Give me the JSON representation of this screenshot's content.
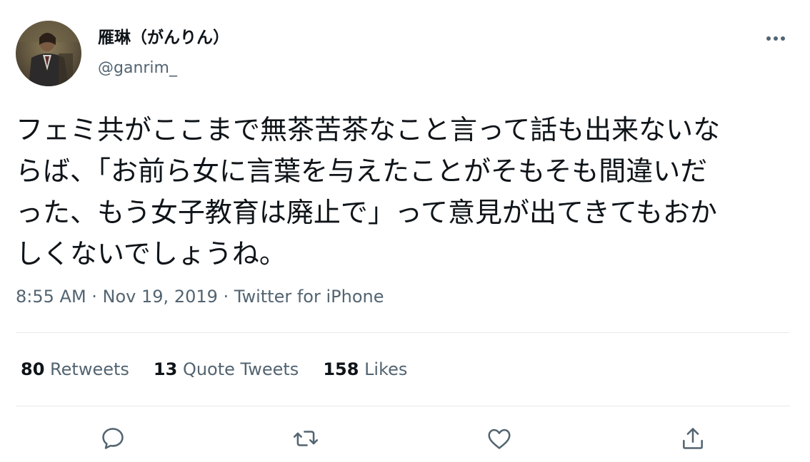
{
  "user": {
    "display_name": "雁琳（がんりん）",
    "handle": "@ganrim_"
  },
  "tweet": {
    "lines": [
      "フェミ共がここまで無茶苦茶なこと言って話も出来ないな",
      "らば、「お前ら女に言葉を与えたことがそもそも間違いだ",
      "った、もう女子教育は廃止で」って意見が出てきてもおか",
      "しくないでしょうね。"
    ]
  },
  "meta": {
    "time": "8:55 AM",
    "separator1": " · ",
    "date": "Nov 19, 2019",
    "separator2": " · ",
    "source": "Twitter for iPhone"
  },
  "stats": {
    "retweets": {
      "count": "80",
      "label": "Retweets"
    },
    "quotes": {
      "count": "13",
      "label": "Quote Tweets"
    },
    "likes": {
      "count": "158",
      "label": "Likes"
    }
  },
  "icons": {
    "more": "more-horizontal-icon",
    "reply": "reply-icon",
    "retweet": "retweet-icon",
    "like": "heart-icon",
    "share": "share-icon"
  },
  "colors": {
    "text_primary": "#0f1419",
    "text_secondary": "#536471",
    "divider": "#e6e9eb"
  }
}
